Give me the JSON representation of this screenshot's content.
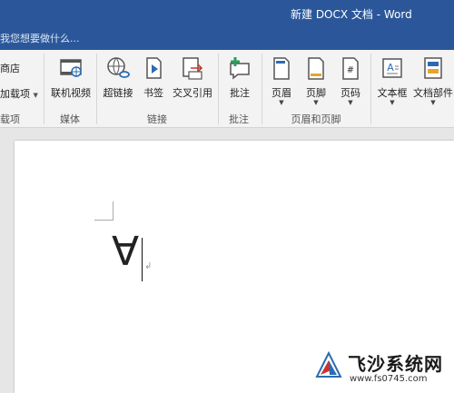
{
  "window": {
    "title": "新建 DOCX 文档 - Word",
    "tell_me_placeholder": "我您想要做什么..."
  },
  "ribbon": {
    "left_partial_items": [
      "商店",
      "加载项",
      "载项"
    ],
    "groups": [
      {
        "label": "媒体",
        "buttons": [
          {
            "label": "联机视频",
            "icon": "online-video-icon"
          }
        ]
      },
      {
        "label": "链接",
        "buttons": [
          {
            "label": "超链接",
            "icon": "hyperlink-icon"
          },
          {
            "label": "书签",
            "icon": "bookmark-icon"
          },
          {
            "label": "交叉引用",
            "icon": "cross-reference-icon"
          }
        ]
      },
      {
        "label": "批注",
        "buttons": [
          {
            "label": "批注",
            "icon": "comment-icon"
          }
        ]
      },
      {
        "label": "页眉和页脚",
        "buttons": [
          {
            "label": "页眉",
            "icon": "header-icon"
          },
          {
            "label": "页脚",
            "icon": "footer-icon"
          },
          {
            "label": "页码",
            "icon": "page-number-icon"
          }
        ]
      },
      {
        "label": "",
        "buttons": [
          {
            "label": "文本框",
            "icon": "text-box-icon"
          },
          {
            "label": "文档部件",
            "icon": "quick-parts-icon"
          }
        ]
      }
    ]
  },
  "document": {
    "content": "∀",
    "paragraph_mark": "↲"
  },
  "watermark": {
    "brand": "飞沙系统网",
    "url": "www.fs0745.com"
  },
  "colors": {
    "title_bar": "#2b579a",
    "ribbon": "#f3f3f3",
    "page": "#ffffff",
    "accent_green": "#2e9e5b",
    "accent_blue": "#2b6cb0"
  }
}
